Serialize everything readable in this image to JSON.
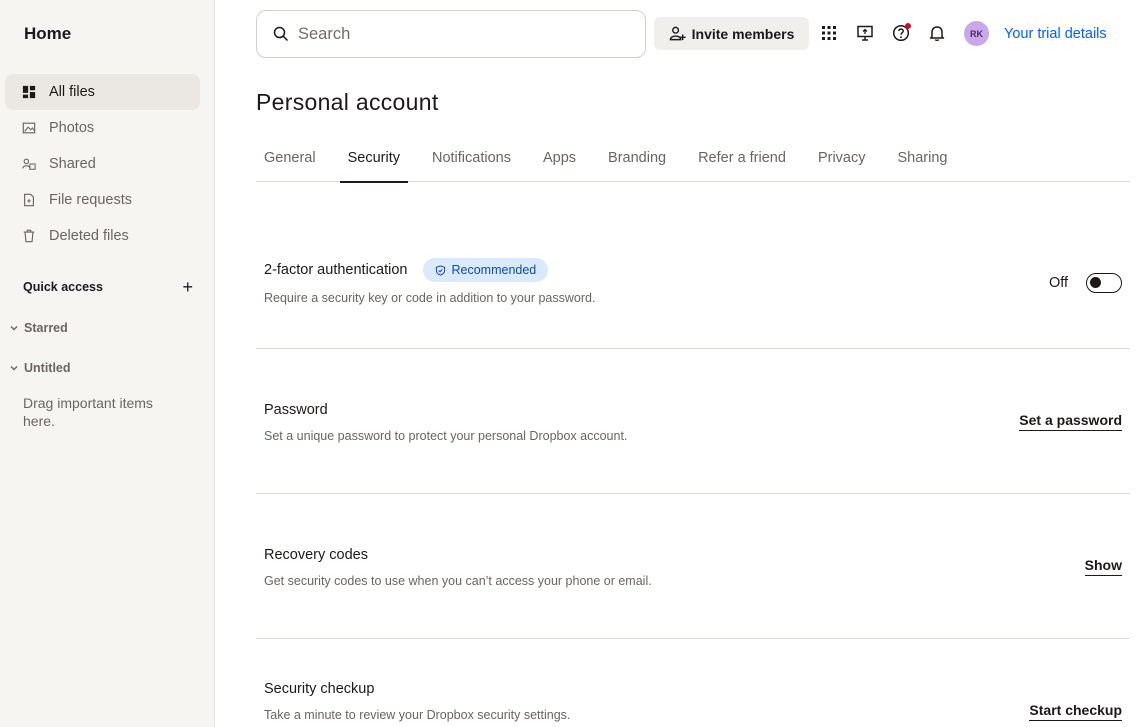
{
  "sidebar": {
    "home": "Home",
    "items": [
      {
        "label": "All files",
        "icon": "folders-icon"
      },
      {
        "label": "Photos",
        "icon": "photo-icon"
      },
      {
        "label": "Shared",
        "icon": "shared-icon"
      },
      {
        "label": "File requests",
        "icon": "file-request-icon"
      },
      {
        "label": "Deleted files",
        "icon": "trash-icon"
      }
    ],
    "quick_access": "Quick access",
    "quick_access_add": "+",
    "starred": "Starred",
    "untitled": "Untitled",
    "drag_text": "Drag important items here."
  },
  "topbar": {
    "search_placeholder": "Search",
    "invite_label": "Invite members",
    "avatar_initials": "RK",
    "avatar_color": "#c9a7e8",
    "trial_label": "Your trial details",
    "link_color": "#0061fe",
    "notification_dot_color": "#c8102e"
  },
  "main": {
    "title": "Personal account",
    "tabs": [
      "General",
      "Security",
      "Notifications",
      "Apps",
      "Branding",
      "Refer a friend",
      "Privacy",
      "Sharing"
    ],
    "active_tab": "Security",
    "rows": [
      {
        "title": "2-factor authentication",
        "badge": "Recommended",
        "desc": "Require a security key or code in addition to your password.",
        "toggle_label": "Off",
        "toggle_on": false
      },
      {
        "title": "Password",
        "desc": "Set a unique password to protect your personal Dropbox account.",
        "action": "Set a password"
      },
      {
        "title": "Recovery codes",
        "desc": "Get security codes to use when you can’t access your phone or email.",
        "action": "Show"
      },
      {
        "title": "Security checkup",
        "desc": "Take a minute to review your Dropbox security settings.",
        "action": "Start checkup"
      }
    ]
  }
}
